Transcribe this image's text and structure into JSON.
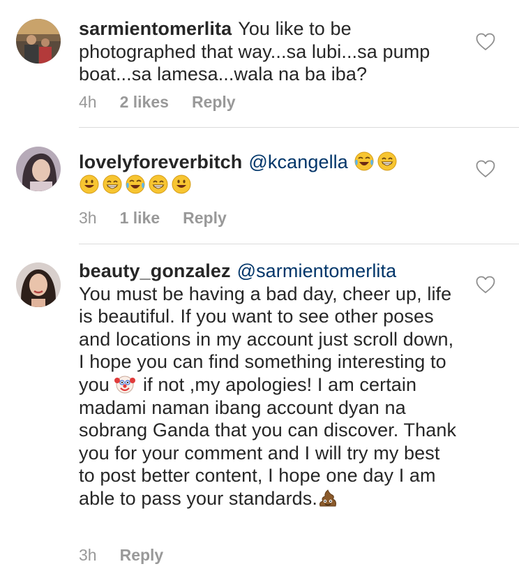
{
  "comments": [
    {
      "username": "sarmientomerlita",
      "text": "You like to be photographed that way...sa lubi...sa pump boat...sa lamesa...wala na ba iba?",
      "time": "4h",
      "likes": "2 likes",
      "reply": "Reply"
    },
    {
      "username": "lovelyforeverbitch",
      "mention": "@kcangella",
      "emojis_line1": [
        "tears-of-joy-emoji",
        "grinning-emoji"
      ],
      "emojis_line2": [
        "smiley-emoji",
        "grinning-emoji",
        "tears-of-joy-emoji",
        "grinning-emoji",
        "smiley-emoji"
      ],
      "time": "3h",
      "likes": "1 like",
      "reply": "Reply"
    },
    {
      "username": "beauty_gonzalez",
      "mention": "@sarmientomerlita",
      "text_part1": "You must be having a bad day, cheer up, life is beautiful. If you want to see other poses and locations in my account just scroll down, I hope you can find something interesting to you",
      "text_part2": " if not ,my apologies! I am certain madami naman ibang account dyan na sobrang Ganda that you can discover.  Thank you for your comment and I will try my best to post better content, I hope one day I am able to pass your standards.",
      "emoji_clown": "clown-emoji",
      "emoji_poop": "poop-emoji",
      "time": "3h",
      "reply": "Reply"
    }
  ],
  "icons": {
    "like": "heart-outline-icon"
  },
  "colors": {
    "text": "#262626",
    "meta": "#999999",
    "mention": "#003569",
    "divider": "#dbdbdb"
  }
}
